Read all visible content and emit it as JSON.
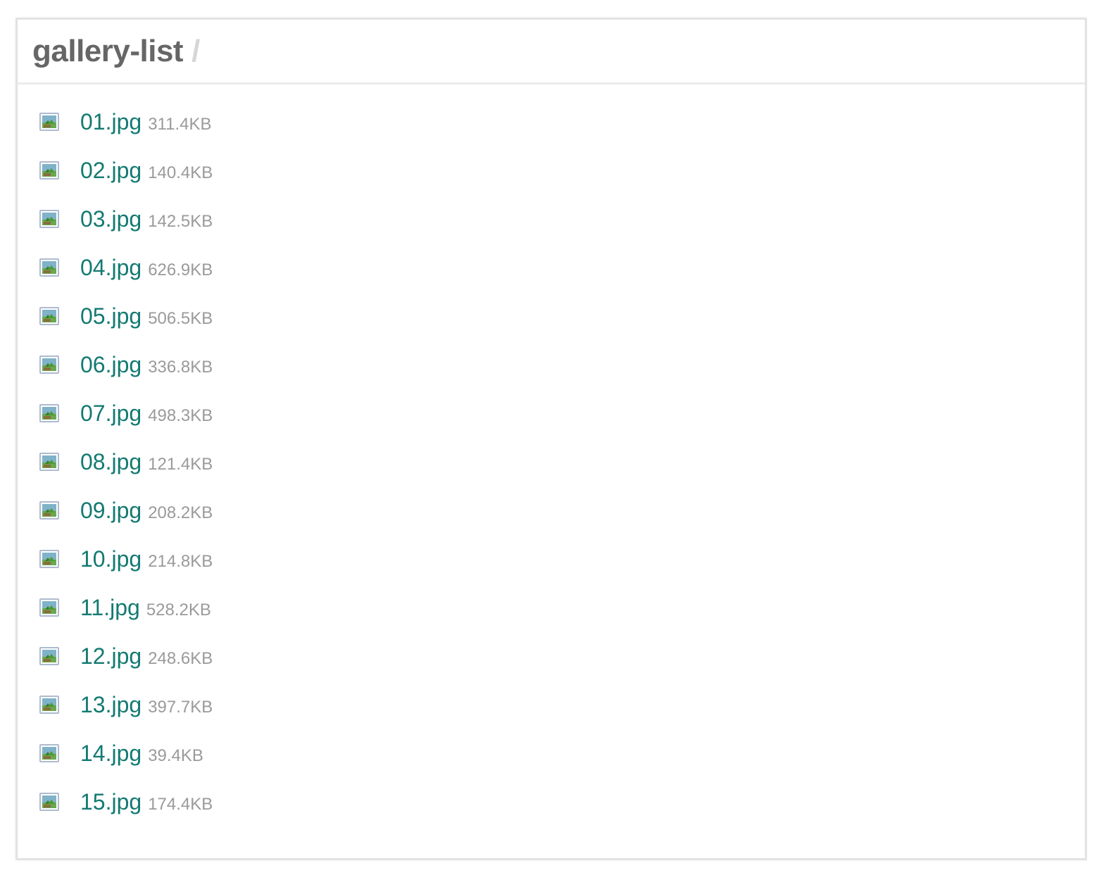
{
  "header": {
    "title": "gallery-list",
    "separator": "/"
  },
  "files": [
    {
      "name": "01.jpg",
      "size": "311.4KB",
      "icon": "image-file-icon"
    },
    {
      "name": "02.jpg",
      "size": "140.4KB",
      "icon": "image-file-icon"
    },
    {
      "name": "03.jpg",
      "size": "142.5KB",
      "icon": "image-file-icon"
    },
    {
      "name": "04.jpg",
      "size": "626.9KB",
      "icon": "image-file-icon"
    },
    {
      "name": "05.jpg",
      "size": "506.5KB",
      "icon": "image-file-icon"
    },
    {
      "name": "06.jpg",
      "size": "336.8KB",
      "icon": "image-file-icon"
    },
    {
      "name": "07.jpg",
      "size": "498.3KB",
      "icon": "image-file-icon"
    },
    {
      "name": "08.jpg",
      "size": "121.4KB",
      "icon": "image-file-icon"
    },
    {
      "name": "09.jpg",
      "size": "208.2KB",
      "icon": "image-file-icon"
    },
    {
      "name": "10.jpg",
      "size": "214.8KB",
      "icon": "image-file-icon"
    },
    {
      "name": "11.jpg",
      "size": "528.2KB",
      "icon": "image-file-icon"
    },
    {
      "name": "12.jpg",
      "size": "248.6KB",
      "icon": "image-file-icon"
    },
    {
      "name": "13.jpg",
      "size": "397.7KB",
      "icon": "image-file-icon"
    },
    {
      "name": "14.jpg",
      "size": "39.4KB",
      "icon": "image-file-icon"
    },
    {
      "name": "15.jpg",
      "size": "174.4KB",
      "icon": "image-file-icon"
    }
  ],
  "colors": {
    "link": "#137a72",
    "title": "#666666",
    "size": "#9a9a9a",
    "separator": "#d6d6d6",
    "border": "#e3e3e3"
  }
}
